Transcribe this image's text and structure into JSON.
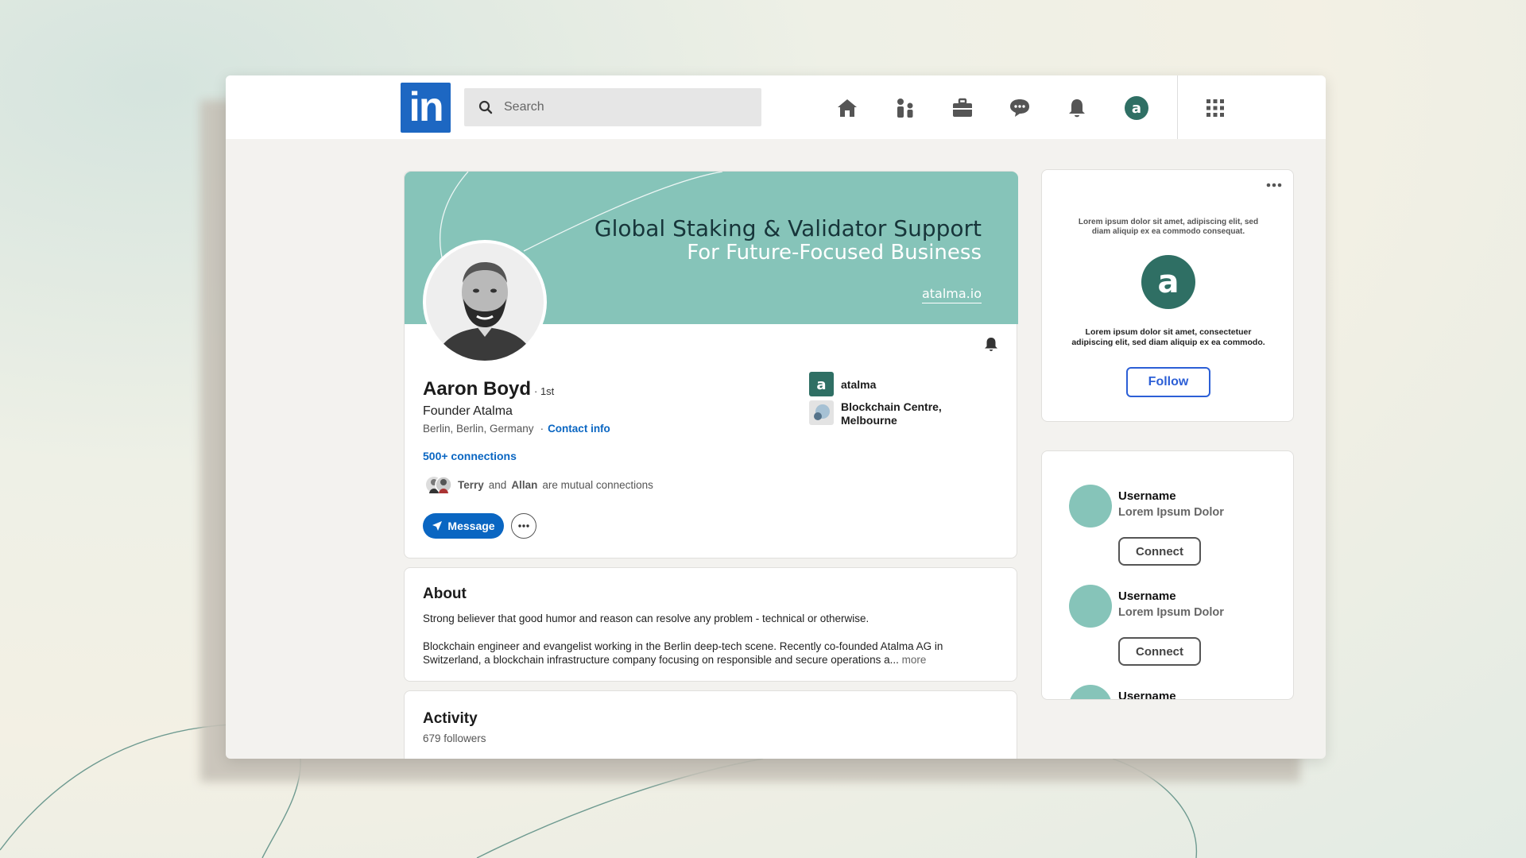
{
  "nav": {
    "logo_text": "in",
    "search_placeholder": "Search",
    "icons": [
      "home-icon",
      "my-network-icon",
      "jobs-icon",
      "messaging-icon",
      "notifications-icon",
      "me-icon",
      "work-grid-icon"
    ]
  },
  "banner": {
    "title": "Global Staking & Validator Support",
    "subtitle": "For Future-Focused Business",
    "url": "atalma.io"
  },
  "profile": {
    "name": "Aaron Boyd",
    "degree": "· 1st",
    "headline": "Founder Atalma",
    "location": "Berlin, Berlin, Germany",
    "location_separator": "·",
    "contact_info": "Contact info",
    "connections": "500+ connections",
    "mutual_a": "Terry",
    "mutual_and": "and",
    "mutual_b": "Allan",
    "mutual_suffix": "are mutual connections",
    "message_button": "Message",
    "company": "atalma",
    "education": "Blockchain Centre, Melbourne"
  },
  "about": {
    "heading": "About",
    "para1": "Strong believer that good humor and reason can resolve any problem - technical or otherwise.",
    "para2": "Blockchain engineer and evangelist working in the Berlin deep-tech scene. Recently co-founded Atalma AG in Switzerland, a blockchain infrastructure company focusing on responsible and secure operations a...",
    "more": "more"
  },
  "activity": {
    "heading": "Activity",
    "followers": "679 followers"
  },
  "ad": {
    "top_text": "Lorem ipsum dolor sit amet, adipiscing elit, sed diam aliquip ex ea commodo consequat.",
    "logo_letter": "a",
    "bottom_text": "Lorem ipsum dolor sit amet, consectetuer adipiscing elit, sed diam aliquip ex ea commodo.",
    "follow_button": "Follow"
  },
  "suggestions": [
    {
      "username": "Username",
      "subtitle": "Lorem Ipsum Dolor",
      "button": "Connect"
    },
    {
      "username": "Username",
      "subtitle": "Lorem Ipsum Dolor",
      "button": "Connect"
    },
    {
      "username": "Username"
    }
  ],
  "colors": {
    "brand_blue": "#0a66c2",
    "teal": "#86c4b9",
    "dark_teal": "#2f6f64"
  }
}
